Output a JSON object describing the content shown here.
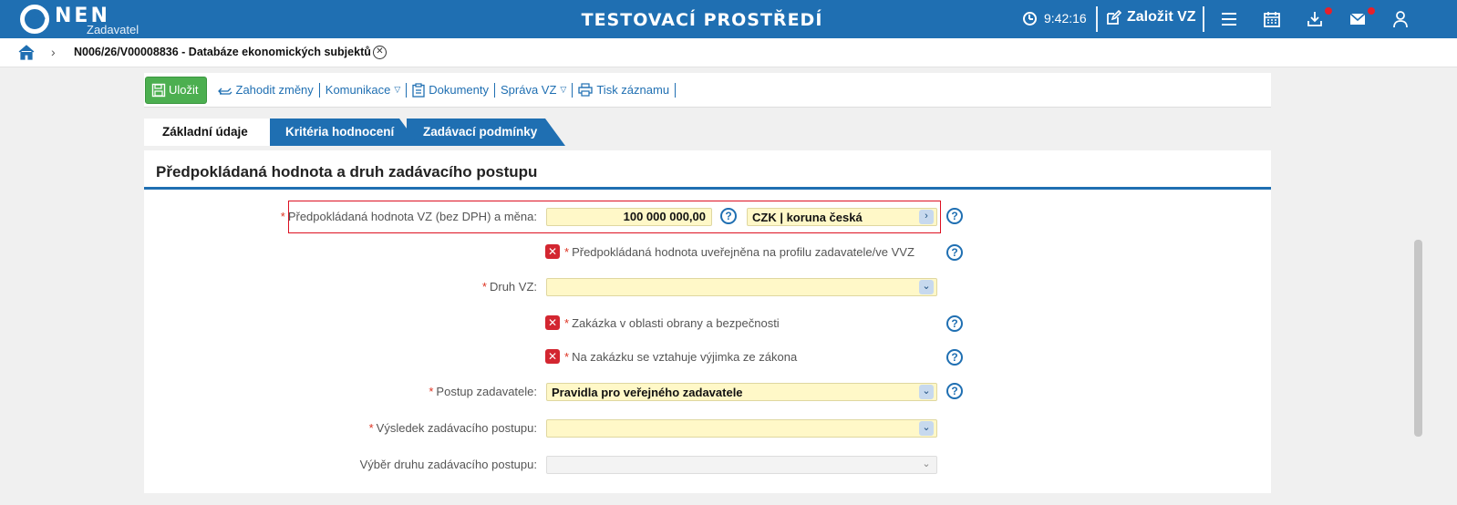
{
  "header": {
    "logo": "NEN",
    "logo_sub": "Zadavatel",
    "env_title": "TESTOVACÍ PROSTŘEDÍ",
    "time": "9:42:16",
    "create_label": "Založit VZ"
  },
  "breadcrumb": {
    "item": "N006/26/V00008836 - Databáze ekonomických subjektů"
  },
  "toolbar": {
    "save": "Uložit",
    "discard": "Zahodit změny",
    "communication": "Komunikace",
    "documents": "Dokumenty",
    "vz_management": "Správa VZ",
    "print": "Tisk záznamu"
  },
  "tabs": [
    {
      "label": "Základní údaje",
      "active": true
    },
    {
      "label": "Kritéria hodnocení",
      "active": false
    },
    {
      "label": "Zadávací podmínky",
      "active": false
    }
  ],
  "section": {
    "title": "Předpokládaná hodnota a druh zadávacího postupu"
  },
  "form": {
    "estimated_value_label": "Předpokládaná hodnota VZ (bez DPH) a měna:",
    "estimated_value": "100 000 000,00",
    "currency": "CZK | koruna česká",
    "published_label": "Předpokládaná hodnota uveřejněna na profilu zadavatele/ve VVZ",
    "type_label": "Druh VZ:",
    "type_value": "",
    "defense_label": "Zakázka v oblasti obrany a bezpečnosti",
    "exception_label": "Na zakázku se vztahuje výjimka ze zákona",
    "procedure_label": "Postup zadavatele:",
    "procedure_value": "Pravidla pro veřejného zadavatele",
    "result_label": "Výsledek zadávacího postupu:",
    "result_value": "",
    "selection_label": "Výběr druhu zadávacího postupu:",
    "selection_value": ""
  }
}
